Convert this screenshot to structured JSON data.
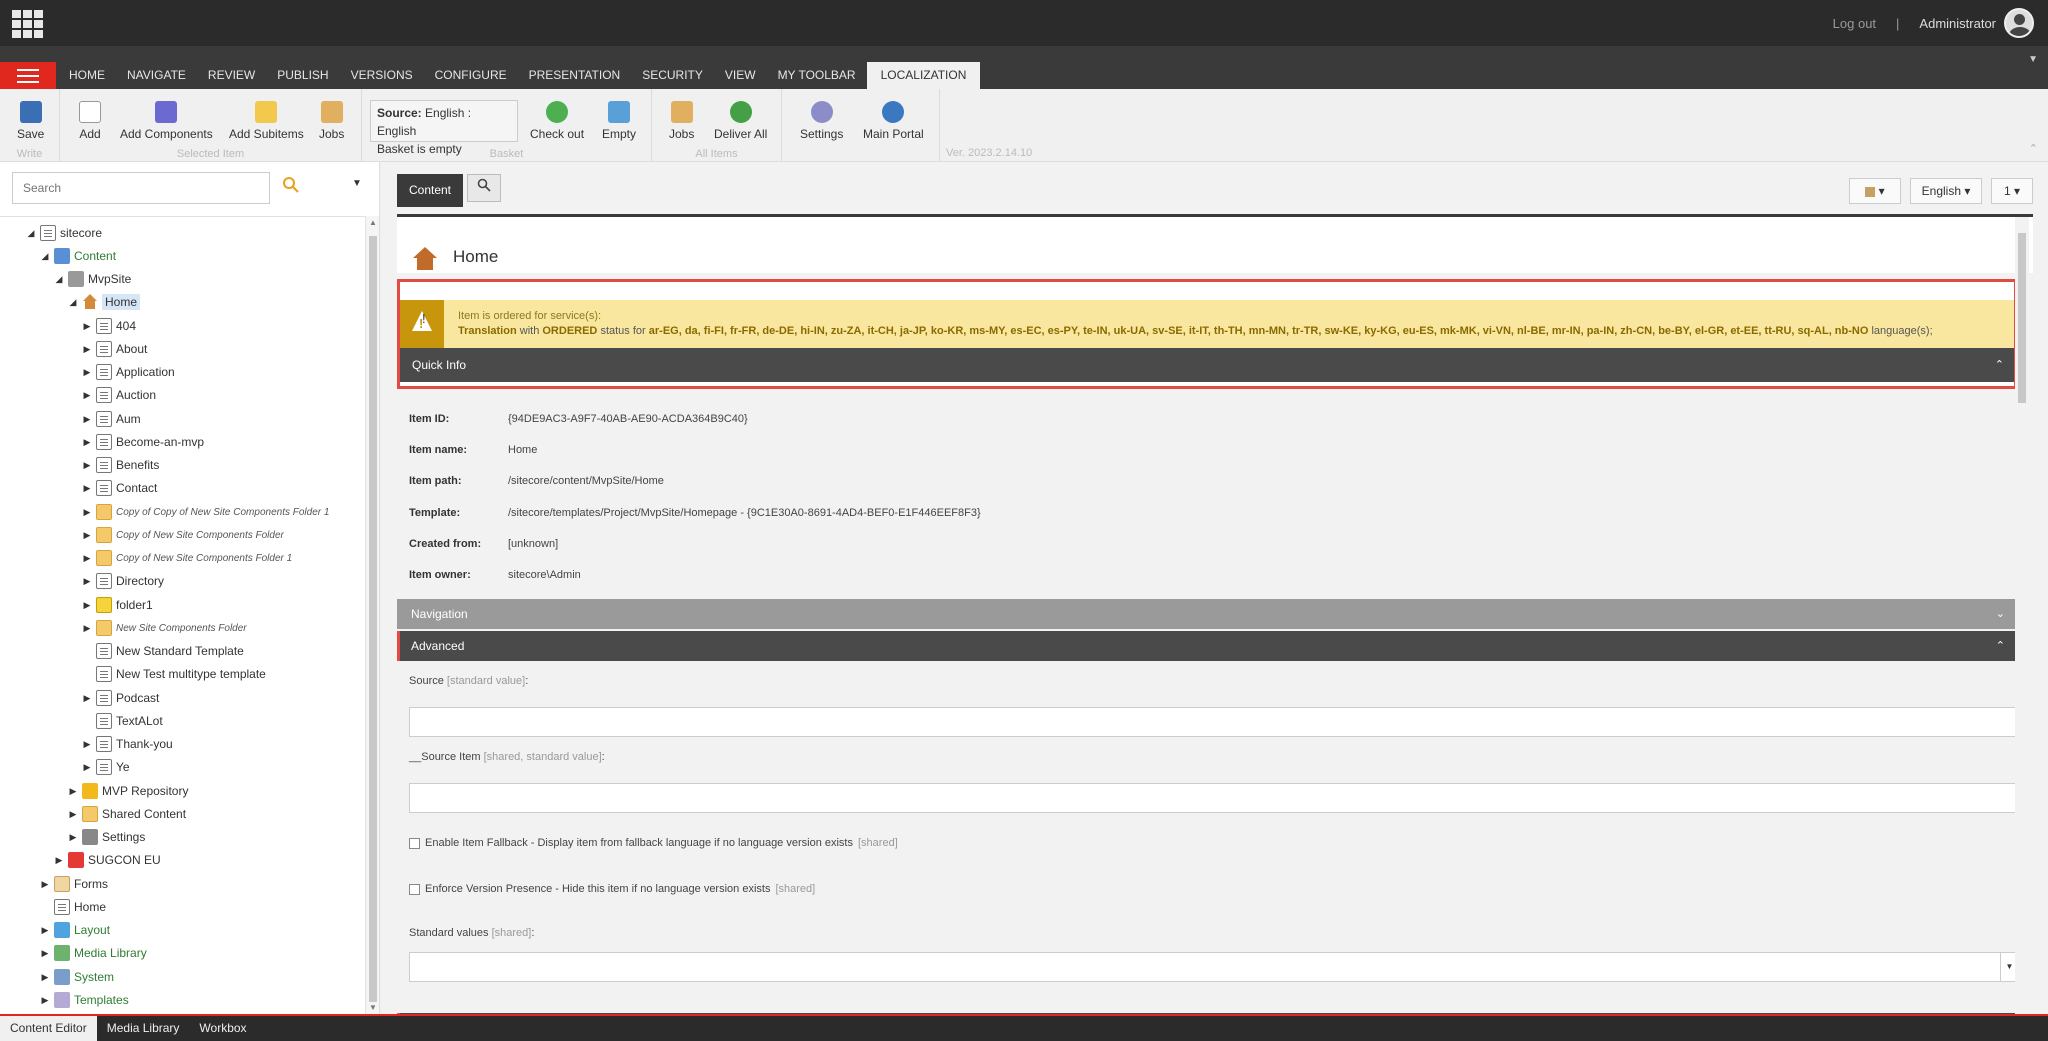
{
  "topbar": {
    "logout": "Log out",
    "separator": "|",
    "user": "Administrator"
  },
  "tabs": [
    "HOME",
    "NAVIGATE",
    "REVIEW",
    "PUBLISH",
    "VERSIONS",
    "CONFIGURE",
    "PRESENTATION",
    "SECURITY",
    "VIEW",
    "MY TOOLBAR",
    "LOCALIZATION"
  ],
  "ribbon": {
    "write": {
      "label": "Write",
      "save": "Save"
    },
    "selected": {
      "label": "Selected Item",
      "add": "Add",
      "add_components": "Add Components",
      "add_subitems": "Add Subitems",
      "jobs": "Jobs"
    },
    "basket": {
      "label": "Basket",
      "source_label": "Source:",
      "source_value": "English : English",
      "status": "Basket is empty",
      "checkout": "Check out",
      "empty": "Empty"
    },
    "allitems": {
      "label": "All Items",
      "jobs": "Jobs",
      "deliver_all": "Deliver All"
    },
    "other": {
      "settings": "Settings",
      "main_portal": "Main Portal"
    },
    "version": "Ver. 2023.2.14.10"
  },
  "search": {
    "placeholder": "Search"
  },
  "tree": {
    "sitecore": "sitecore",
    "content": "Content",
    "mvpsite": "MvpSite",
    "home": "Home",
    "children": [
      "404",
      "About",
      "Application",
      "Auction",
      "Aum",
      "Become-an-mvp",
      "Benefits",
      "Contact"
    ],
    "copy_folders": [
      "Copy of Copy of New Site Components Folder 1",
      "Copy of New Site Components Folder",
      "Copy of New Site Components Folder 1"
    ],
    "directory": "Directory",
    "folder1": "folder1",
    "new_site_components": "New Site Components Folder",
    "new_standard_template": "New Standard Template",
    "new_test_multitype": "New Test multitype template",
    "podcast": "Podcast",
    "textalot": "TextALot",
    "thankyou": "Thank-you",
    "ye": "Ye",
    "mvp_repository": "MVP Repository",
    "shared_content": "Shared Content",
    "settings": "Settings",
    "sugcon": "SUGCON EU",
    "forms": "Forms",
    "home_root": "Home",
    "layout": "Layout",
    "media_library": "Media Library",
    "system": "System",
    "templates": "Templates"
  },
  "content_tabs": {
    "content": "Content",
    "language": "English",
    "version": "1"
  },
  "item": {
    "title": "Home",
    "warning_line1": "Item is ordered for service(s):",
    "warning_prefix": "Translation",
    "warning_with": "with",
    "warning_status": "ORDERED",
    "warning_mid": "status for",
    "warning_languages": "ar-EG, da, fi-FI, fr-FR, de-DE, hi-IN, zu-ZA, it-CH, ja-JP, ko-KR, ms-MY, es-EC, es-PY, te-IN, uk-UA, sv-SE, it-IT, th-TH, mn-MN, tr-TR, sw-KE, ky-KG, eu-ES, mk-MK, vi-VN, nl-BE, mr-IN, pa-IN, zh-CN, be-BY, el-GR, et-EE, tt-RU, sq-AL, nb-NO",
    "warning_suffix": "language(s);"
  },
  "quick_info": {
    "title": "Quick Info",
    "rows": [
      {
        "label": "Item ID:",
        "value": "{94DE9AC3-A9F7-40AB-AE90-ACDA364B9C40}"
      },
      {
        "label": "Item name:",
        "value": "Home"
      },
      {
        "label": "Item path:",
        "value": "/sitecore/content/MvpSite/Home"
      },
      {
        "label": "Template:",
        "value": "/sitecore/templates/Project/MvpSite/Homepage - {9C1E30A0-8691-4AD4-BEF0-E1F446EEF8F3}"
      },
      {
        "label": "Created from:",
        "value": "[unknown]"
      },
      {
        "label": "Item owner:",
        "value": "sitecore\\Admin"
      }
    ]
  },
  "sections": {
    "navigation": "Navigation",
    "advanced": "Advanced"
  },
  "fields": {
    "source": "Source",
    "source_meta": "[standard value]",
    "source_item": "__Source Item",
    "source_item_meta": "[shared, standard value]",
    "fallback": "Enable Item Fallback - Display item from fallback language if no language version exists",
    "fallback_meta": "[shared]",
    "enforce": "Enforce Version Presence - Hide this item if no language version exists",
    "enforce_meta": "[shared]",
    "standard_values": "Standard values",
    "standard_values_meta": "[shared]"
  },
  "taskbar": [
    "Content Editor",
    "Media Library",
    "Workbox"
  ]
}
